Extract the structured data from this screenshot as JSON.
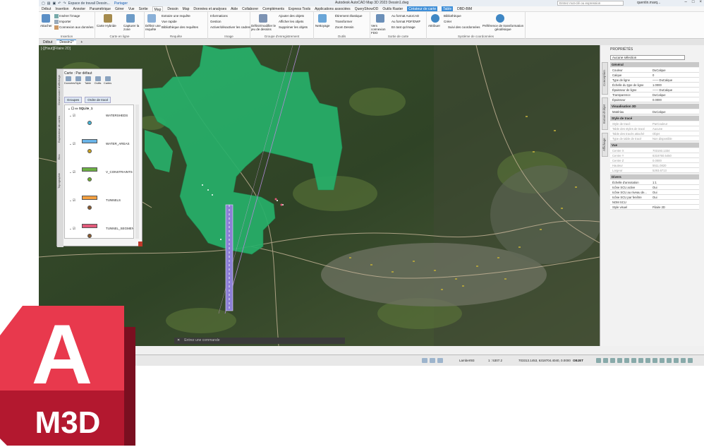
{
  "app": {
    "title": "Autodesk AutoCAD Map 3D 2023   Dessin1.dwg",
    "workspace": "Espace de travail Dessin...",
    "share": "Partager",
    "search_placeholder": "Entrez mot-clé ou expression",
    "user": "quentin.marq..."
  },
  "menu": {
    "items": [
      "Début",
      "Insertion",
      "Annoter",
      "Paramétrique",
      "Gérer",
      "Vue",
      "Sortie",
      "Map",
      "Dessin",
      "Map",
      "Données et analyses",
      "Aide",
      "Collaborer",
      "Compléments",
      "Express Tools",
      "Applications associées",
      "QueryShowOD",
      "Outils Raster",
      "Créateur de carte",
      "Table",
      "DBD-BIM"
    ],
    "active_index": 7,
    "ctx_indices": [
      18,
      19
    ]
  },
  "ribbon": {
    "insertion": {
      "title": "Insertion",
      "attacher": "Attacher",
      "insert_image": "Insérer l'image",
      "importer": "Importer",
      "connect_data": "Connexion aux données"
    },
    "carte": {
      "title": "Carte en ligne",
      "hybride": "Carte Hybride",
      "capture": "Capturer la zone"
    },
    "requete": {
      "title": "Requête",
      "definir": "Définir une requête",
      "extraire": "Extraire une requête",
      "vue_rapide": "Vue rapide",
      "biblio": "Bibliothèque des requêtes"
    },
    "image": {
      "title": "Image",
      "info": "Informations",
      "gestion": "Gestion",
      "activer": "Activer/désactiver les cadres"
    },
    "groupe": {
      "title": "Groupe d'enregistrement",
      "def": "Définir/modifier le jeu de dessins",
      "ajouter": "Ajouter des objets",
      "afficher": "Afficher les objets",
      "supprimer": "Supprimer les objets"
    },
    "outils": {
      "title": "Outils",
      "nettoyage": "Nettoyage",
      "elastique": "Étirement élastique",
      "transformer": "Transformer",
      "zoom": "Zoom Dessin"
    },
    "sortie": {
      "title": "Sortie de carte",
      "conn": "Vers connexion FDO",
      "autocad": "Au format AutoCAD",
      "pdf": "Au format PDF/DWF",
      "image": "En tant qu'image"
    },
    "systeme": {
      "title": "Système de coordonnées",
      "attribuer": "Attribuer",
      "biblio": "Bibliothèque",
      "creer": "Créer",
      "suivi": "Suivi des coordonnées",
      "pref": "Préférence de transformation géodésique"
    }
  },
  "doctabs": [
    "Début",
    "Dessin1*",
    "+"
  ],
  "map": {
    "view_label": "[-][Haut][Filaire 2D]",
    "command_prompt": "Entrez une commande",
    "colors": {
      "polygon": "#27b06a",
      "road": "#c9b79a",
      "pipe": "#8c7fd6"
    }
  },
  "carte_panel": {
    "header": "Carte :  Par défaut",
    "vtabs": [
      "Gestionnaire d'affichage",
      "Explorateur de cartes",
      "Bloc",
      "Topographie"
    ],
    "tools": [
      "Données",
      "Style",
      "Table",
      "Outils",
      "Cartes"
    ],
    "subtabs": [
      "Groupes",
      "Ordre de tracé"
    ],
    "root": "SQLite_1",
    "layers": [
      {
        "name": "WATERSHEDS",
        "swatch": null,
        "dot": "#45b4d6"
      },
      {
        "name": "WATER_AREAS",
        "swatch": "#6ab4e8",
        "dot": "#c8a020"
      },
      {
        "name": "V_CONSTRAINTS",
        "swatch": "#6cb044",
        "dot": "#70b030"
      },
      {
        "name": "TUNNELS",
        "swatch": "#f4a040",
        "dot": "#8a5a30"
      },
      {
        "name": "TUNNEL_SEGMENTS",
        "swatch": "#e25a7a",
        "dot": "#8a5a30"
      }
    ]
  },
  "properties": {
    "title": "PROPRIÉTÉS",
    "selection": "Aucune sélection",
    "vtabs": [
      "Conception",
      "Extrait d'objet",
      "Affichage"
    ],
    "sections": [
      {
        "name": "Général",
        "rows": [
          [
            "Couleur",
            "DuCalque"
          ],
          [
            "Calque",
            "0"
          ],
          [
            "Type de ligne",
            "—— DuCalque"
          ],
          [
            "Échelle du type de ligne",
            "1.0000"
          ],
          [
            "Épaisseur de ligne",
            "—— DuCalque"
          ],
          [
            "Transparence",
            "DuCalque"
          ],
          [
            "Épaisseur",
            "0.0000"
          ]
        ]
      },
      {
        "name": "Visualisation 3D",
        "rows": [
          [
            "Matériau",
            "DuCalque"
          ]
        ]
      },
      {
        "name": "Style de tracé",
        "rows": [
          [
            "Style de tracé",
            "ParCouleur"
          ],
          [
            "Table des styles de tracé",
            "Aucune"
          ],
          [
            "Table des tracés attaché",
            "Objet"
          ],
          [
            "Type de table de tracé",
            "Non disponible"
          ]
        ]
      },
      {
        "name": "Vue",
        "rows": [
          [
            "Centre X",
            "703193.1334"
          ],
          [
            "Centre Y",
            "6318760.5450"
          ],
          [
            "Centre Z",
            "0.0000"
          ],
          [
            "Hauteur",
            "5511.0820"
          ],
          [
            "Largeur",
            "5293.6713"
          ]
        ]
      },
      {
        "name": "Divers",
        "rows": [
          [
            "Échelle d'annotation",
            "1:1"
          ],
          [
            "Icône SCU active",
            "Oui"
          ],
          [
            "Icône SCU au niveau de...",
            "Oui"
          ],
          [
            "Icône SCU par fenêtre",
            "Oui"
          ],
          [
            "NOM SCU",
            ""
          ],
          [
            "Style visuel",
            "Filaire 2D"
          ]
        ]
      }
    ],
    "dim_sections": [
      2,
      3
    ]
  },
  "status": {
    "projection": "Lambert93",
    "scale": "1 : 5307.2",
    "coords": "703313.1453, 6318704.4040, 0.0000",
    "mode": "OBJET"
  },
  "logo": {
    "letter": "A",
    "product": "M3D",
    "color_top": "#e8394d",
    "color_bottom": "#b3182f",
    "color_dark": "#7a0f20"
  }
}
